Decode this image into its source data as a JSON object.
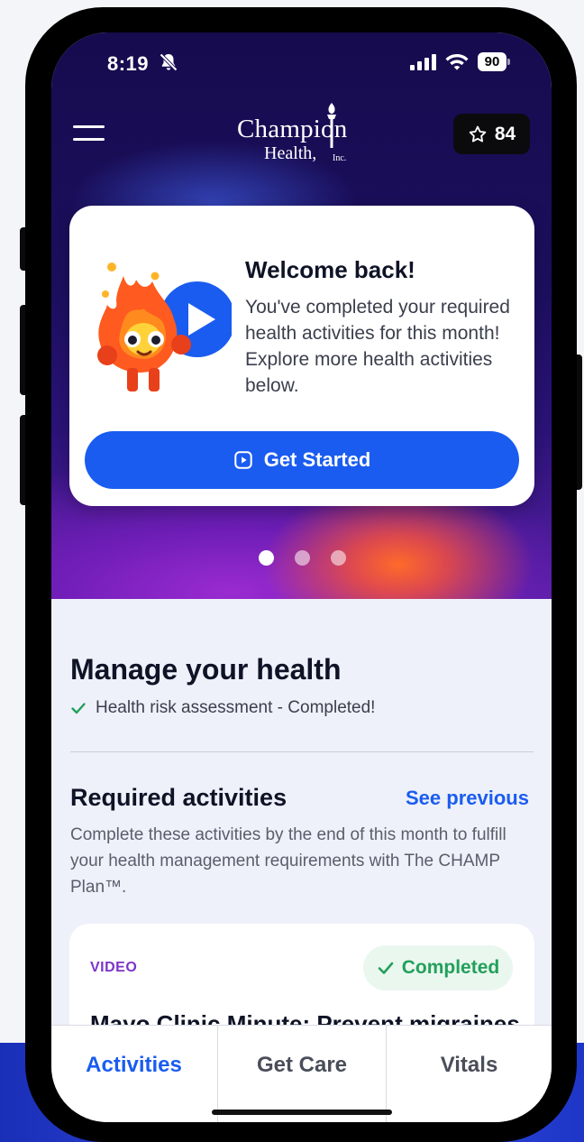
{
  "status_bar": {
    "time": "8:19",
    "battery": "90",
    "mute_icon": "bell-slash-icon",
    "signal_icon": "cellular-signal-icon",
    "wifi_icon": "wifi-icon"
  },
  "header": {
    "logo": {
      "line1": "Champion",
      "line2": "Health,",
      "suffix": "Inc."
    },
    "points": "84",
    "points_icon": "star-outline-icon",
    "menu_icon": "hamburger-menu-icon"
  },
  "welcome_card": {
    "title": "Welcome back!",
    "body": "You've completed your required health activities for this month! Explore more health activities below.",
    "button_label": "Get Started",
    "button_icon": "play-square-icon",
    "illustration": "flame-mascot-play-illustration"
  },
  "carousel": {
    "count": 3,
    "active_index": 0
  },
  "manage": {
    "title": "Manage your health",
    "hra_status": "Health risk assessment - Completed!"
  },
  "required": {
    "title": "Required activities",
    "see_previous": "See previous",
    "description": "Complete these activities by the end of this month to fulfill your health management requirements with The CHAMP Plan™."
  },
  "activity": {
    "type": "VIDEO",
    "status": "Completed",
    "title": "Mayo Clinic Minute: Prevent migraines"
  },
  "tabs": [
    {
      "label": "Activities",
      "active": true
    },
    {
      "label": "Get Care",
      "active": false
    },
    {
      "label": "Vitals",
      "active": false
    }
  ],
  "colors": {
    "accent": "#1a5cf0",
    "success": "#22a05a",
    "video_tag": "#7c33c9",
    "hero_dark": "#160b4e"
  }
}
